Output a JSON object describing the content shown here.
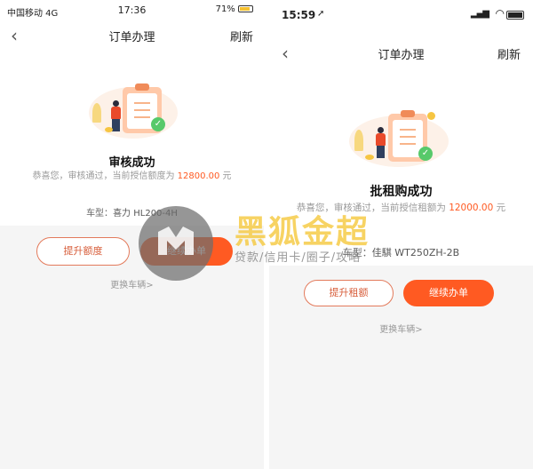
{
  "left": {
    "status": {
      "carrier": "中国移动 4G",
      "time": "17:36",
      "battery": "71%"
    },
    "nav": {
      "back": "‹",
      "title": "订单办理",
      "refresh": "刷新"
    },
    "result_title": "审核成功",
    "desc_prefix": "恭喜您，审核通过，当前授信额度为 ",
    "amount": "12800.00",
    "desc_suffix": " 元",
    "car_label": "车型：",
    "car_value": "喜力 HL200-4H",
    "btn_raise": "提升额度",
    "btn_continue": "继续办单",
    "change_car": "更换车辆>"
  },
  "right": {
    "status": {
      "time": "15:59"
    },
    "nav": {
      "back": "‹",
      "title": "订单办理",
      "refresh": "刷新"
    },
    "result_title": "批租购成功",
    "desc_prefix": "恭喜您，审核通过，当前授信租额为 ",
    "amount": "12000.00",
    "desc_suffix": " 元",
    "car_label": "车型：",
    "car_value": "佳騏 WT250ZH-2B",
    "btn_raise": "提升租额",
    "btn_continue": "继续办单",
    "change_car": "更换车辆>"
  },
  "watermark": {
    "brand": "黑狐金超",
    "tagline": "贷款/信用卡/圈子/攻略"
  },
  "colors": {
    "accent": "#ff5a22",
    "check": "#57c96a",
    "illustration": "#ffc9a9"
  }
}
